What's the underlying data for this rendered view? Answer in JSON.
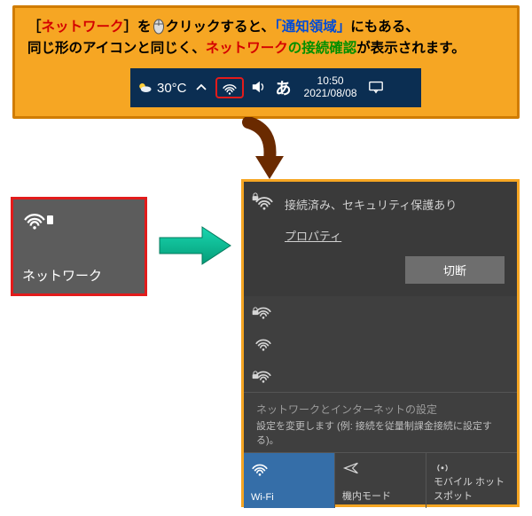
{
  "banner": {
    "p1": "［",
    "p_red1": "ネットワーク",
    "p2": "］を",
    "p3": "クリックすると、",
    "p_blue1": "「通知領域」",
    "p4": "にもある、",
    "p5": "同じ形のアイコンと同じく、",
    "p_red2": "ネットワーク",
    "p_green": "の接続確認",
    "p6": "が表示されます。"
  },
  "taskbar": {
    "temp": "30°C",
    "ime": "あ",
    "time": "10:50",
    "date": "2021/08/08"
  },
  "tile_left": {
    "label": "ネットワーク"
  },
  "flyout": {
    "status": "接続済み、セキュリティ保護あり",
    "properties": "プロパティ",
    "disconnect": "切断",
    "settings_title": "ネットワークとインターネットの設定",
    "settings_desc": "設定を変更します (例: 接続を従量制課金接続に設定する)。",
    "tile_wifi": "Wi-Fi",
    "tile_airplane": "機内モード",
    "tile_hotspot": "モバイル ホットスポット"
  }
}
